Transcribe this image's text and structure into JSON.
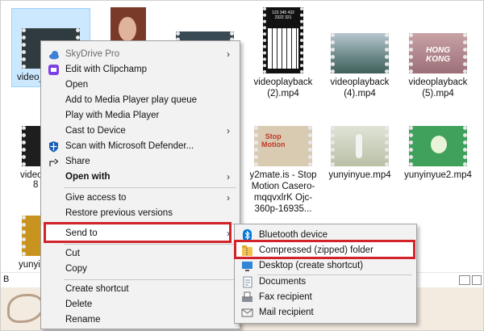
{
  "explorer": {
    "files": [
      {
        "name": "video_",
        "selected": true
      },
      {
        "name": ""
      },
      {
        "name": ""
      },
      {
        "name": "videoplayback (2).mp4"
      },
      {
        "name": "videoplayback (4).mp4"
      },
      {
        "name": "videoplayback (5).mp4"
      },
      {
        "name": "video"
      },
      {
        "name": "y2mate.is - Stop Motion Casero-mqqvxlrK Ojc-360p-16935..."
      },
      {
        "name": "yunyinyue.mp4"
      },
      {
        "name": "yunyinyue2.mp4"
      },
      {
        "name": "yunyir"
      }
    ],
    "partial_labels": [
      "8",
      "B"
    ],
    "piano_overlay": "123 345 432\n2322 321",
    "hongkong_overlay": "HONG KONG",
    "stopmotion_overlay": "Stop\nMotion"
  },
  "context_menu": {
    "items": [
      {
        "label": "SkyDrive Pro",
        "icon": "skydrive-icon",
        "arrow": true,
        "disabled": true
      },
      {
        "label": "Edit with Clipchamp",
        "icon": "clipchamp-icon"
      },
      {
        "label": "Open"
      },
      {
        "label": "Add to Media Player play queue"
      },
      {
        "label": "Play with Media Player"
      },
      {
        "label": "Cast to Device",
        "arrow": true
      },
      {
        "label": "Scan with Microsoft Defender...",
        "icon": "defender-icon"
      },
      {
        "label": "Share",
        "icon": "share-icon"
      },
      {
        "label": "Open with",
        "arrow": true,
        "bold": true
      },
      {
        "label": "Give access to",
        "arrow": true
      },
      {
        "label": "Restore previous versions"
      },
      {
        "label": "Send to",
        "arrow": true,
        "highlighted": true
      },
      {
        "label": "Cut"
      },
      {
        "label": "Copy"
      },
      {
        "label": "Create shortcut"
      },
      {
        "label": "Delete"
      },
      {
        "label": "Rename"
      }
    ]
  },
  "send_to_menu": {
    "items": [
      {
        "label": "Bluetooth device",
        "icon": "bluetooth-icon"
      },
      {
        "label": "Compressed (zipped) folder",
        "icon": "zip-folder-icon",
        "highlighted": true
      },
      {
        "label": "Desktop (create shortcut)",
        "icon": "desktop-icon"
      },
      {
        "label": "Documents",
        "icon": "documents-icon"
      },
      {
        "label": "Fax recipient",
        "icon": "fax-icon"
      },
      {
        "label": "Mail recipient",
        "icon": "mail-icon"
      }
    ]
  },
  "colors": {
    "highlight_border": "#d2232a",
    "menu_bg": "#f2f2f2",
    "selection_bg": "#cce8ff",
    "bluetooth": "#0078d7",
    "defender": "#1a5fb4"
  }
}
